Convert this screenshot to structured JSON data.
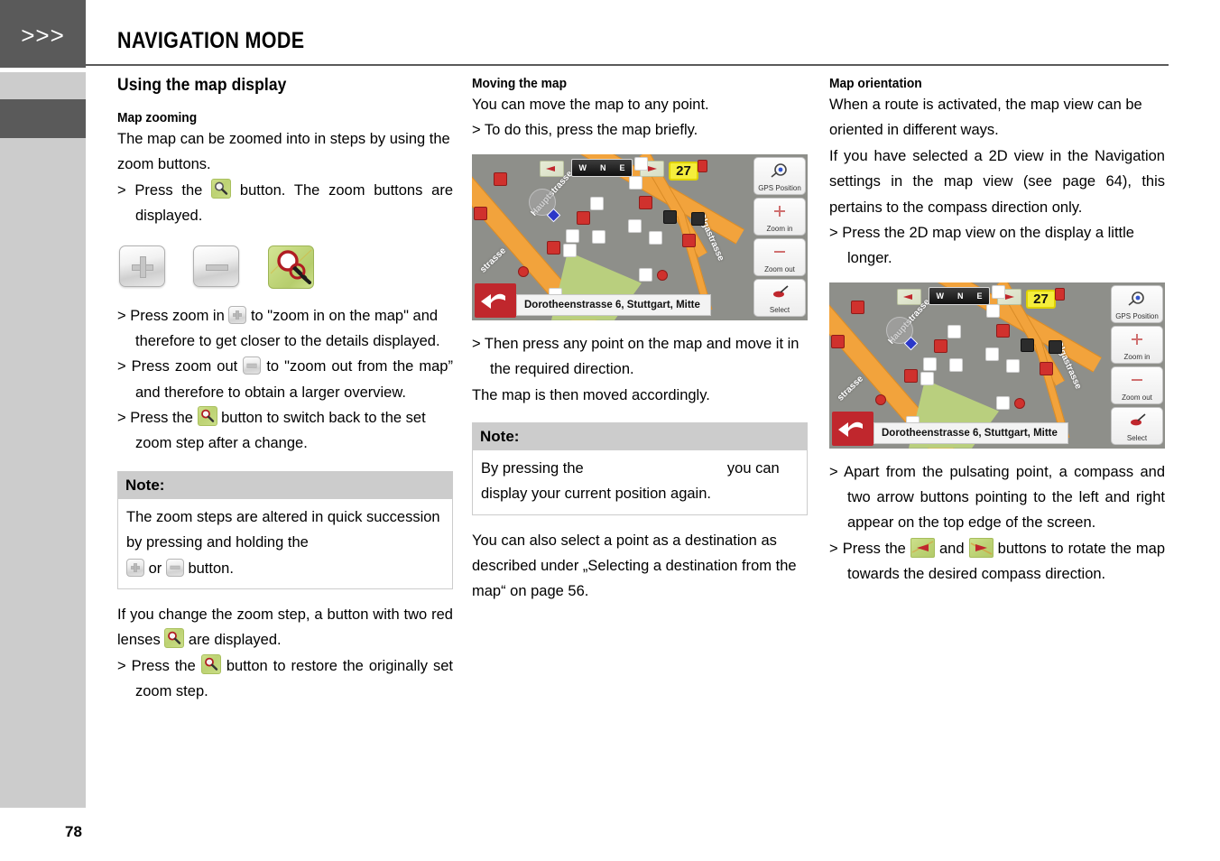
{
  "sidebar": {
    "chevrons": ">>>"
  },
  "header": {
    "title": "NAVIGATION MODE"
  },
  "footer": {
    "page_number": "78"
  },
  "columns": {
    "left": {
      "section_title": "Using the map display",
      "sub_title": "Map zooming",
      "intro": "The map can be zoomed into in steps by using the zoom buttons.",
      "step1_a": "> Press  the",
      "step1_b": "button.  The  zoom  buttons are displayed.",
      "buttons": [
        {
          "name": "zoom-in-button",
          "label": "+"
        },
        {
          "name": "zoom-out-button",
          "label": "−"
        },
        {
          "name": "restore-zoom-button",
          "label": "magnifier"
        }
      ],
      "step2_a": "> Press zoom in",
      "step2_b": "to \"zoom in on the map\" and therefore to get closer to the details displayed.",
      "step3_a": "> Press zoom out",
      "step3_b": "to \"zoom out from the map” and therefore to obtain a larger overview.",
      "step4_a": "> Press the",
      "step4_b": "button to switch back to the set zoom step after a change.",
      "note": {
        "head": "Note:",
        "body_a": "The  zoom  steps  are  altered  in  quick succession by pressing and holding the",
        "body_or": "or",
        "body_b": "button."
      },
      "after_a": "If  you  change  the  zoom  step,  a  button with two red lenses",
      "after_b": "are displayed.",
      "step5_a": "> Press  the",
      "step5_b": "button  to  restore  the originally set zoom step."
    },
    "middle": {
      "sub_title": "Moving the map",
      "line1": "You can move the map to any point.",
      "line2": "> To do this, press the map briefly.",
      "step1": "> Then press any point on the map and move it in the required direction.",
      "line3": "The map is then moved accordingly.",
      "note": {
        "head": "Note:",
        "body_a": "By pressing the",
        "body_b": "you can display your current position again."
      },
      "closing": "You can also select a point as a destination as described under „Selecting a destination from the map“ on page 56."
    },
    "right": {
      "sub_title": "Map orientation",
      "para1": "When a route is activated, the map view can be oriented in different ways.",
      "para2": "If  you  have  selected  a  2D  view  in  the Navigation settings in the map view (see page  64),  this  pertains  to  the  compass direction only.",
      "step1": "> Press the 2D map view on the display a little longer.",
      "step2": "> Apart  from  the  pulsating  point,  a compass  and  two  arrow  buttons pointing to the left and right appear on the top edge of the screen.",
      "step3_a": "> Press  the",
      "step3_and": "and",
      "step3_b": "buttons  to  rotate  the  map  towards  the  desired compass direction."
    }
  },
  "navmap": {
    "streets": [
      "Hauptstrasse",
      "Olgastrasse",
      "strasse"
    ],
    "compass": {
      "w": "W",
      "n": "N",
      "e": "E"
    },
    "speed_limit": "27",
    "address": "Dorotheenstrasse 6, Stuttgart, Mitte",
    "side_buttons": [
      {
        "name": "gps-position-button",
        "label": "GPS Position"
      },
      {
        "name": "zoom-in-button",
        "label": "Zoom in"
      },
      {
        "name": "zoom-out-button",
        "label": "Zoom out"
      },
      {
        "name": "select-button",
        "label": "Select"
      }
    ]
  },
  "colors": {
    "sidebar_dark": "#5a5a5a",
    "sidebar_light": "#cccccc",
    "note_head": "#cccccc",
    "road": "#f2a33c",
    "poi_red": "#d0312d",
    "speed_yellow": "#f5ee3c",
    "green_button": "#c2d77c"
  }
}
